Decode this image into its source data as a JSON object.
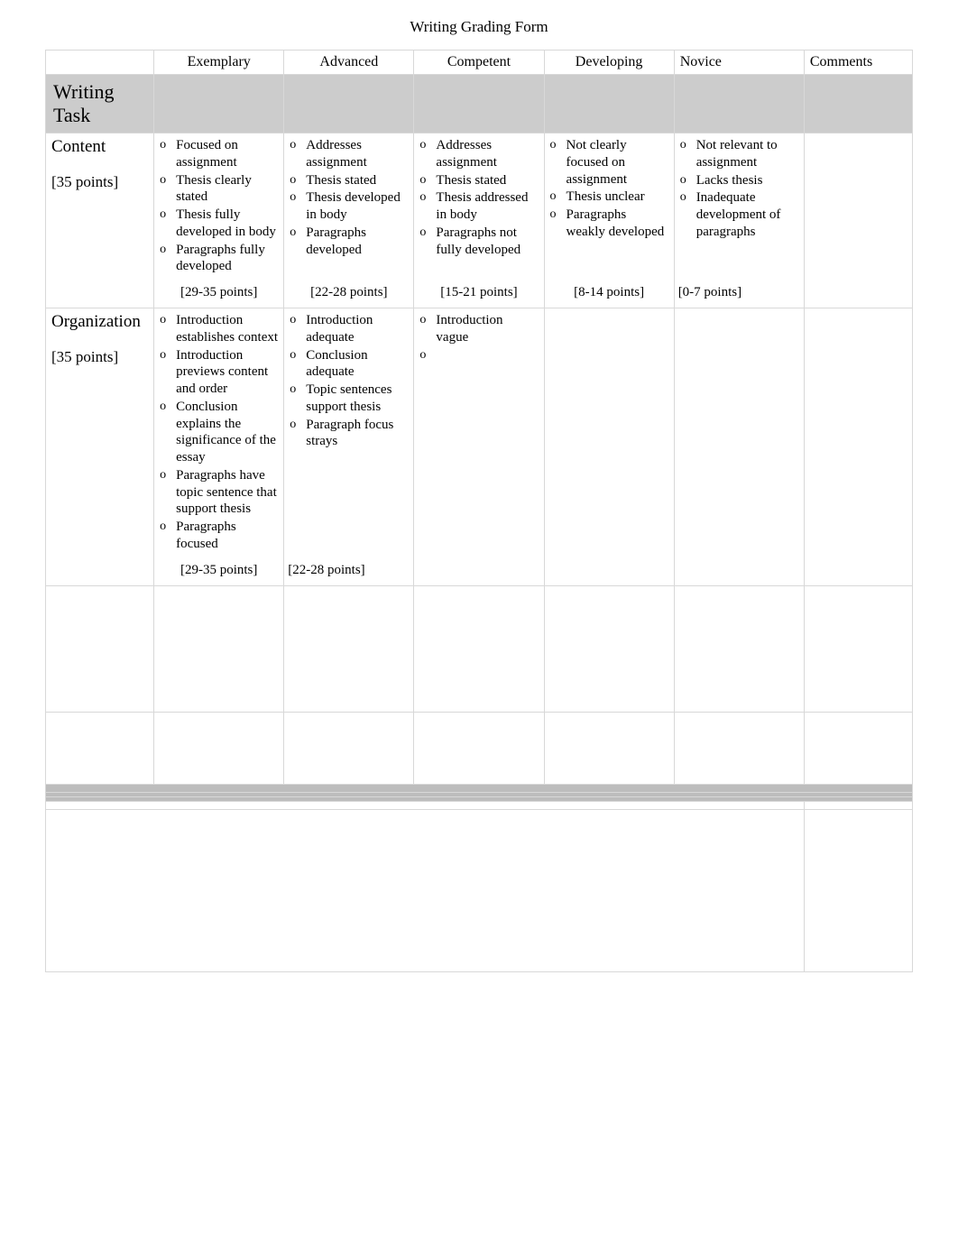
{
  "title": "Writing Grading Form",
  "headers": {
    "blank": "",
    "levels": [
      "Exemplary",
      "Advanced",
      "Competent",
      "Developing",
      "Novice"
    ],
    "comments": "Comments"
  },
  "section": "Writing Task",
  "rows": [
    {
      "criteria": "Content",
      "points_label": "[35 points]",
      "cells": [
        {
          "bullets": [
            "Focused on assignment",
            "Thesis clearly stated",
            "Thesis fully developed in body",
            "Paragraphs fully developed"
          ],
          "range": "[29-35 points]"
        },
        {
          "bullets": [
            "Addresses assignment",
            "Thesis stated",
            "Thesis developed in body",
            "Paragraphs developed"
          ],
          "range": "[22-28 points]"
        },
        {
          "bullets": [
            "Addresses assignment",
            "Thesis stated",
            "Thesis addressed in body",
            "Paragraphs not fully developed"
          ],
          "range": "[15-21 points]"
        },
        {
          "bullets": [
            "Not clearly focused on assignment",
            "Thesis unclear",
            "Paragraphs weakly developed"
          ],
          "range": "[8-14 points]"
        },
        {
          "bullets": [
            "Not relevant to assignment",
            "Lacks thesis",
            "Inadequate development of paragraphs"
          ],
          "range": "[0-7 points]"
        }
      ]
    },
    {
      "criteria": "Organization",
      "points_label": "[35 points]",
      "cells": [
        {
          "bullets": [
            "Introduction establishes context",
            "Introduction previews content and order",
            "Conclusion explains the significance of the essay",
            "Paragraphs have topic sentence that support thesis",
            "Paragraphs focused"
          ],
          "range": "[29-35 points]"
        },
        {
          "bullets": [
            "Introduction adequate",
            "Conclusion adequate",
            "Topic sentences support thesis",
            "Paragraph focus strays"
          ],
          "range": "[22-28 points]"
        },
        {
          "bullets": [
            "Introduction vague",
            ""
          ],
          "range": ""
        },
        {
          "bullets": [],
          "range": ""
        },
        {
          "bullets": [],
          "range": ""
        }
      ]
    },
    {
      "criteria": "",
      "points_label": "",
      "cells": [
        {
          "bullets": [],
          "range": ""
        },
        {
          "bullets": [],
          "range": ""
        },
        {
          "bullets": [],
          "range": ""
        },
        {
          "bullets": [],
          "range": ""
        },
        {
          "bullets": [],
          "range": ""
        }
      ]
    },
    {
      "criteria": "",
      "points_label": "",
      "cells": [
        {
          "bullets": [],
          "range": ""
        },
        {
          "bullets": [],
          "range": ""
        },
        {
          "bullets": [],
          "range": ""
        },
        {
          "bullets": [],
          "range": ""
        },
        {
          "bullets": [],
          "range": ""
        }
      ]
    }
  ],
  "score_title": "",
  "score_lines": [
    "",
    ""
  ],
  "general_comments_label": ""
}
